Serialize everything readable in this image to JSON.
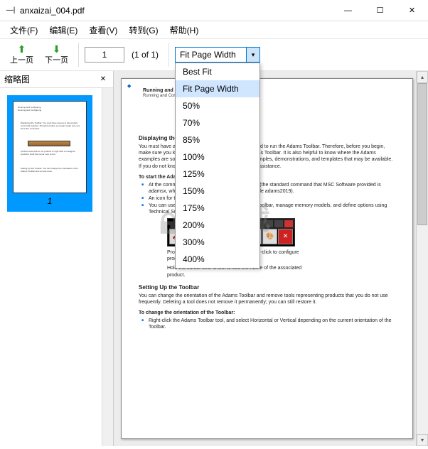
{
  "window": {
    "title": "anxaizai_004.pdf"
  },
  "menu": {
    "file": "文件(F)",
    "edit": "编辑(E)",
    "view": "查看(V)",
    "goto": "转到(G)",
    "help": "帮助(H)"
  },
  "toolbar": {
    "prev": "上一页",
    "next": "下一页",
    "page_current": "1",
    "page_of": "(1 of 1)",
    "zoom_value": "Fit Page Width"
  },
  "zoom_options": [
    "Best Fit",
    "Fit Page Width",
    "50%",
    "70%",
    "85%",
    "100%",
    "125%",
    "150%",
    "175%",
    "200%",
    "300%",
    "400%"
  ],
  "zoom_selected_index": 1,
  "sidebar": {
    "title": "缩略图",
    "thumb_number": "1"
  },
  "doc": {
    "hdr1": "Running and configuring",
    "hdr2": "Running and Configuring",
    "s_display": "Displaying the Adams Toolbar",
    "p_display1": "You must have access to the product command required to run the Adams Toolbar. Therefore, before you begin, make sure you know the command to display the Adams Toolbar. It is also helpful to know where the Adams examples are so you can troubleshoot and access examples, demonstrations, and templates that may be available. If you do not know, see your system administrator for assistance.",
    "p_display2": "To start the Adams Toolbar:",
    "b_d1": "At the command prompt, enter the Adams Toolbar (the standard command that MSC Software provided is adamsx, where x is the version number, for example adams2019).",
    "b_d2": "An icon for the Adams Toolbar is shown here.",
    "b_d3": "You can use the Adams Toolbar to quickly set up Toolbar, manage memory models, and define options using Technical Support resources and more",
    "p_tools1": "Product tools - Click to run product or right-click to configure products and create user libraries.",
    "p_tools2": "Hold the cursor over a tool to see the name of the associated product.",
    "s_setup": "Setting Up the Toolbar",
    "p_setup1": "You can change the orientation of the Adams Toolbar and remove tools representing products that you do not use frequently. Deleting a tool does not remove it permanently; you can still restore it.",
    "p_setup2": "To change the orientation of the Toolbar:",
    "b_s1": "Right-click the Adams Toolbar tool, and select Horizontal or Vertical depending on the current orientation of the Toolbar."
  },
  "watermark": {
    "main": "安下载",
    "sub": "anxz.com"
  }
}
